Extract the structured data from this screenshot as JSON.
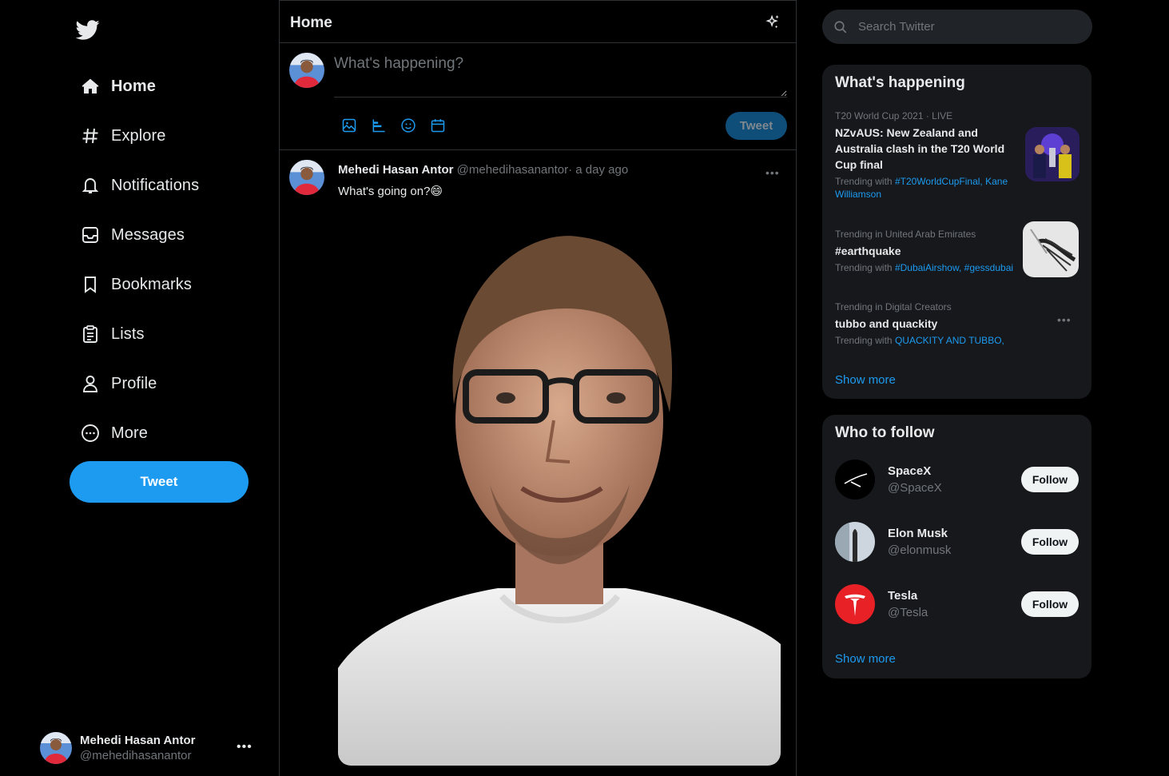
{
  "nav": {
    "items": [
      {
        "label": "Home",
        "icon": "home-icon",
        "active": true
      },
      {
        "label": "Explore",
        "icon": "hashtag-icon"
      },
      {
        "label": "Notifications",
        "icon": "bell-icon"
      },
      {
        "label": "Messages",
        "icon": "inbox-icon"
      },
      {
        "label": "Bookmarks",
        "icon": "bookmark-icon"
      },
      {
        "label": "Lists",
        "icon": "list-icon"
      },
      {
        "label": "Profile",
        "icon": "person-icon"
      },
      {
        "label": "More",
        "icon": "more-circle-icon"
      }
    ],
    "tweet_label": "Tweet",
    "account": {
      "name": "Mehedi Hasan Antor",
      "handle": "@mehedihasanantor"
    }
  },
  "timeline": {
    "title": "Home",
    "composer": {
      "placeholder": "What's happening?",
      "button_label": "Tweet"
    },
    "tweet": {
      "name": "Mehedi Hasan Antor",
      "handle": "@mehedihasanantor",
      "time": "· a day ago",
      "text": "What's going on?😄"
    }
  },
  "search": {
    "placeholder": "Search Twitter"
  },
  "trends": {
    "title": "What's happening",
    "items": [
      {
        "meta": "T20 World Cup 2021 · LIVE",
        "title": "NZvAUS: New Zealand and Australia clash in the T20 World Cup final",
        "with_prefix": "Trending with ",
        "with_tags": "#T20WorldCupFinal, Kane Williamson"
      },
      {
        "meta": "Trending in United Arab Emirates",
        "title": "#earthquake",
        "with_prefix": "Trending with ",
        "with_tags": "#DubaiAirshow, #gessdubai"
      },
      {
        "meta": "Trending in Digital Creators",
        "title": "tubbo and quackity",
        "with_prefix": "Trending with ",
        "with_tags": "QUACKITY AND TUBBO,"
      }
    ],
    "show_more": "Show more"
  },
  "who_to_follow": {
    "title": "Who to follow",
    "items": [
      {
        "name": "SpaceX",
        "handle": "@SpaceX",
        "button": "Follow"
      },
      {
        "name": "Elon Musk",
        "handle": "@elonmusk",
        "button": "Follow"
      },
      {
        "name": "Tesla",
        "handle": "@Tesla",
        "button": "Follow"
      }
    ],
    "show_more": "Show more"
  },
  "colors": {
    "accent": "#1d9bf0",
    "background": "#000000",
    "card": "#16181c",
    "muted": "#71767b"
  }
}
